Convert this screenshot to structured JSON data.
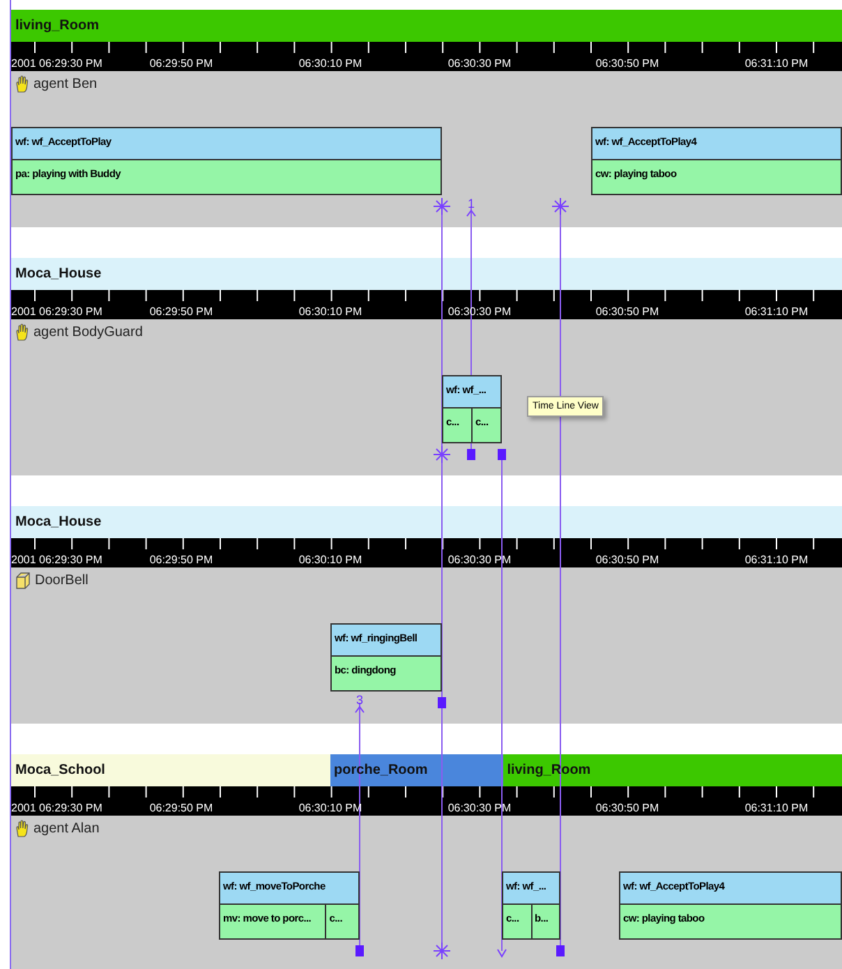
{
  "panels": [
    {
      "locations": [
        {
          "label": "living_Room",
          "color": "#3cc800"
        }
      ],
      "ruler": [
        "2001 06:29:30 PM",
        "06:29:50 PM",
        "06:30:10 PM",
        "06:30:30 PM",
        "06:30:50 PM",
        "06:31:10 PM"
      ],
      "lane": {
        "kind": "agent",
        "label": "agent Ben"
      },
      "activities": [
        {
          "workflow": "wf: wf_AcceptToPlay",
          "tasks": [
            "pa: playing with Buddy"
          ]
        },
        {
          "workflow": "wf: wf_AcceptToPlay4",
          "tasks": [
            "cw: playing taboo"
          ]
        }
      ],
      "markers": [
        {
          "kind": "star"
        },
        {
          "kind": "arrow-up",
          "label": "1"
        },
        {
          "kind": "star"
        }
      ]
    },
    {
      "locations": [
        {
          "label": "Moca_House",
          "color": "#daf2fa"
        }
      ],
      "ruler": [
        "2001 06:29:30 PM",
        "06:29:50 PM",
        "06:30:10 PM",
        "06:30:30 PM",
        "06:30:50 PM",
        "06:31:10 PM"
      ],
      "lane": {
        "kind": "agent",
        "label": "agent BodyGuard"
      },
      "activities": [
        {
          "workflow": "wf: wf_...",
          "tasks": [
            "c...",
            "c..."
          ]
        }
      ],
      "markers": [
        {
          "kind": "star"
        },
        {
          "kind": "square"
        },
        {
          "kind": "square"
        }
      ]
    },
    {
      "locations": [
        {
          "label": "Moca_House",
          "color": "#daf2fa"
        }
      ],
      "ruler": [
        "2001 06:29:30 PM",
        "06:29:50 PM",
        "06:30:10 PM",
        "06:30:30 PM",
        "06:30:50 PM",
        "06:31:10 PM"
      ],
      "lane": {
        "kind": "object",
        "label": "DoorBell"
      },
      "activities": [
        {
          "workflow": "wf: wf_ringingBell",
          "tasks": [
            "bc: dingdong"
          ]
        }
      ],
      "markers": [
        {
          "kind": "arrow-up",
          "label": "3"
        },
        {
          "kind": "square"
        }
      ]
    },
    {
      "locations": [
        {
          "label": "Moca_School",
          "color": "#f8fadc"
        },
        {
          "label": "porche_Room",
          "color": "#4a86dc"
        },
        {
          "label": "living_Room",
          "color": "#3cc800"
        }
      ],
      "ruler": [
        "2001 06:29:30 PM",
        "06:29:50 PM",
        "06:30:10 PM",
        "06:30:30 PM",
        "06:30:50 PM",
        "06:31:10 PM"
      ],
      "lane": {
        "kind": "agent",
        "label": "agent Alan"
      },
      "activities": [
        {
          "workflow": "wf: wf_moveToPorche",
          "tasks": [
            "mv: move to porc...",
            "c..."
          ]
        },
        {
          "workflow": "wf: wf_...",
          "tasks": [
            "c...",
            "b..."
          ]
        },
        {
          "workflow": "wf: wf_AcceptToPlay4",
          "tasks": [
            "cw: playing taboo"
          ]
        }
      ],
      "markers": [
        {
          "kind": "square"
        },
        {
          "kind": "star"
        },
        {
          "kind": "arrow-down"
        },
        {
          "kind": "square"
        }
      ]
    }
  ],
  "tooltip": "Time Line View"
}
